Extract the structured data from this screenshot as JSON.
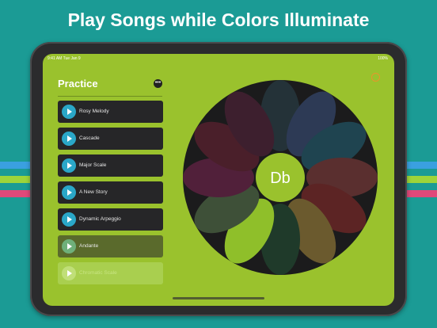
{
  "headline": "Play Songs while Colors Illuminate",
  "status": {
    "time": "9:41 AM  Tue Jan 9",
    "battery": "100%"
  },
  "sidebar": {
    "title": "Practice",
    "songs": [
      {
        "label": "Rosy Melody"
      },
      {
        "label": "Cascade"
      },
      {
        "label": "Major Scale"
      },
      {
        "label": "A New Story"
      },
      {
        "label": "Dynamic Arpeggio"
      },
      {
        "label": "Andante"
      },
      {
        "label": "Chromatic Scale"
      }
    ]
  },
  "wheel": {
    "center_note": "Db",
    "petal_colors": [
      "#243238",
      "#2d3a55",
      "#1f4450",
      "#5a2f2f",
      "#5c2424",
      "#6b5a2e",
      "#1f3a2a",
      "#8fbf2a",
      "#3e5038",
      "#51203a",
      "#4a1f2a",
      "#3d1f2e"
    ]
  },
  "colors": {
    "accent": "#9ac22d",
    "play": "#2aa7c8",
    "device": "#2b2b2d"
  }
}
